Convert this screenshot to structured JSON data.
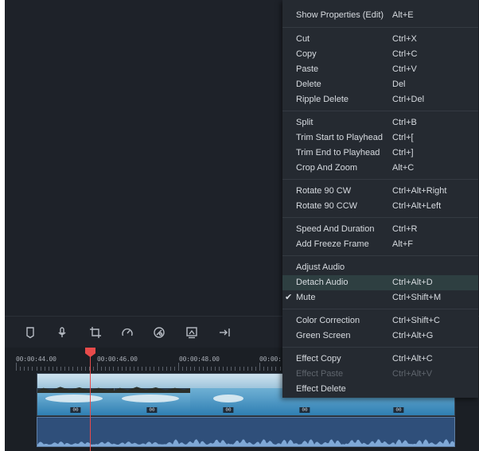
{
  "menu": {
    "items": [
      {
        "label": "Show Properties (Edit)",
        "shortcut": "Alt+E"
      },
      {
        "label": "Cut",
        "shortcut": "Ctrl+X"
      },
      {
        "label": "Copy",
        "shortcut": "Ctrl+C"
      },
      {
        "label": "Paste",
        "shortcut": "Ctrl+V"
      },
      {
        "label": "Delete",
        "shortcut": "Del"
      },
      {
        "label": "Ripple Delete",
        "shortcut": "Ctrl+Del"
      },
      {
        "label": "Split",
        "shortcut": "Ctrl+B"
      },
      {
        "label": "Trim Start to Playhead",
        "shortcut": "Ctrl+["
      },
      {
        "label": "Trim End to Playhead",
        "shortcut": "Ctrl+]"
      },
      {
        "label": "Crop And Zoom",
        "shortcut": "Alt+C"
      },
      {
        "label": "Rotate 90 CW",
        "shortcut": "Ctrl+Alt+Right"
      },
      {
        "label": "Rotate 90 CCW",
        "shortcut": "Ctrl+Alt+Left"
      },
      {
        "label": "Speed And Duration",
        "shortcut": "Ctrl+R"
      },
      {
        "label": "Add Freeze Frame",
        "shortcut": "Alt+F"
      },
      {
        "label": "Adjust Audio",
        "shortcut": ""
      },
      {
        "label": "Detach Audio",
        "shortcut": "Ctrl+Alt+D",
        "highlighted": true
      },
      {
        "label": "Mute",
        "shortcut": "Ctrl+Shift+M",
        "checked": true
      },
      {
        "label": "Color Correction",
        "shortcut": "Ctrl+Shift+C"
      },
      {
        "label": "Green Screen",
        "shortcut": "Ctrl+Alt+G"
      },
      {
        "label": "Effect Copy",
        "shortcut": "Ctrl+Alt+C"
      },
      {
        "label": "Effect Paste",
        "shortcut": "Ctrl+Alt+V",
        "disabled": true
      },
      {
        "label": "Effect Delete",
        "shortcut": ""
      }
    ],
    "check_mark": "✔"
  },
  "toolbar": {
    "icons": [
      "marker-icon",
      "microphone-icon",
      "crop-icon",
      "speed-icon",
      "color-icon",
      "export-frame-icon",
      "jump-to-end-icon"
    ]
  },
  "timeline": {
    "timecodes": [
      "00:00:44.00",
      "00:00:46.00",
      "00:00:48.00",
      "00:00:"
    ],
    "playhead_color": "#e84b4b"
  },
  "colors": {
    "menu_highlight": "#2e3f41",
    "background": "#1d2128",
    "audio_clip": "#2f4f7a"
  }
}
